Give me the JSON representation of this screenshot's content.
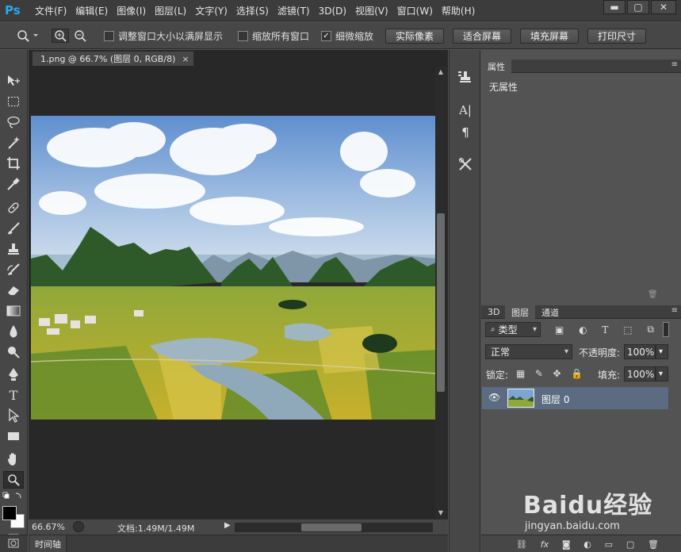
{
  "app": {
    "logo": "Ps"
  },
  "menu": [
    "文件(F)",
    "编辑(E)",
    "图像(I)",
    "图层(L)",
    "文字(Y)",
    "选择(S)",
    "滤镜(T)",
    "3D(D)",
    "视图(V)",
    "窗口(W)",
    "帮助(H)"
  ],
  "window_buttons": {
    "minimize": "▬",
    "maximize": "▢",
    "close": "✕"
  },
  "options": {
    "cb1_label": "调整窗口大小以满屏显示",
    "cb2_label": "缩放所有窗口",
    "cb3_label": "细微缩放",
    "cb3_checked": "✓",
    "btn_actual": "实际像素",
    "btn_fit": "适合屏幕",
    "btn_fill": "填充屏幕",
    "btn_print": "打印尺寸"
  },
  "document": {
    "tab_title": "1.png @ 66.7% (图层 0, RGB/8)",
    "tab_close": "×"
  },
  "status": {
    "zoom": "66.67%",
    "doc_info": "文档:1.49M/1.49M"
  },
  "timeline": {
    "label": "时间轴"
  },
  "properties": {
    "tab": "属性",
    "body": "无属性"
  },
  "layers_panel": {
    "tabs": [
      "3D",
      "图层",
      "通道"
    ],
    "filter_kind": "类型",
    "blend_mode": "正常",
    "opacity_label": "不透明度:",
    "opacity_value": "100%",
    "lock_label": "锁定:",
    "fill_label": "填充:",
    "fill_value": "100%",
    "layer_name": "图层 0"
  },
  "watermark": {
    "brand": "Baidu经验",
    "url": "jingyan.baidu.com"
  },
  "colors": {
    "accent": "#2ba8ee",
    "selected_layer": "#5a6b82",
    "panel": "#535353",
    "doc_bg": "#282828"
  }
}
